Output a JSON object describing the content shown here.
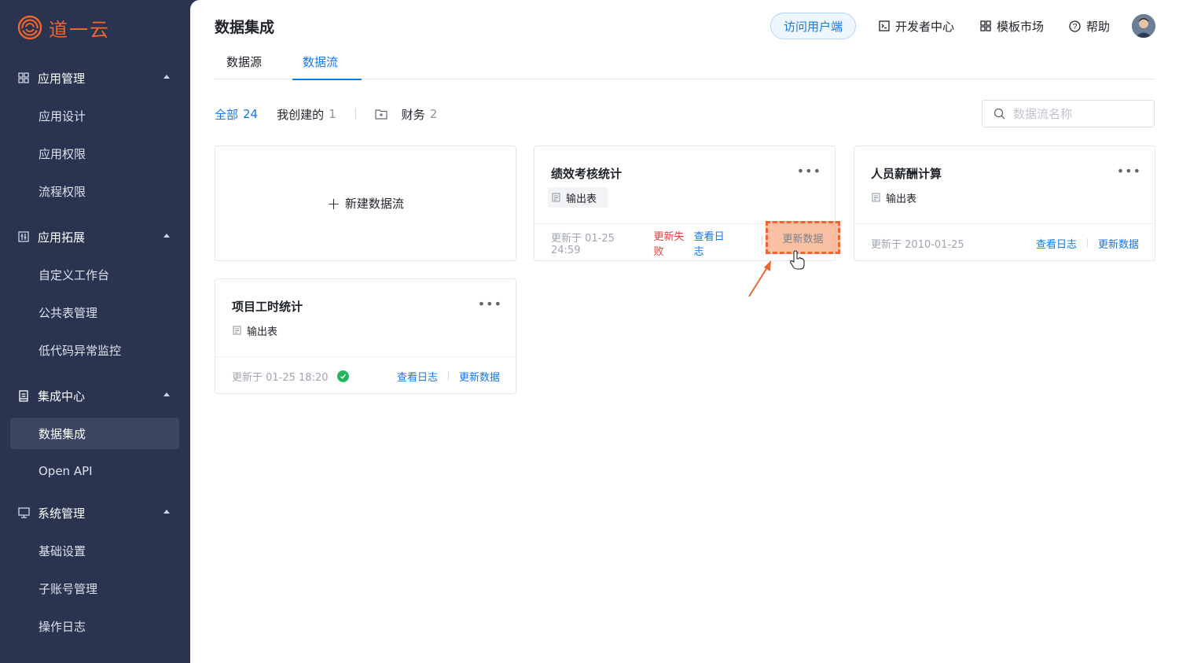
{
  "brand": {
    "name": "道一云",
    "color": "#f0652f"
  },
  "sidebar": {
    "groups": [
      {
        "label": "应用管理",
        "icon": "grid-icon",
        "items": [
          "应用设计",
          "应用权限",
          "流程权限"
        ]
      },
      {
        "label": "应用拓展",
        "icon": "extension-icon",
        "items": [
          "自定义工作台",
          "公共表管理",
          "低代码异常监控"
        ]
      },
      {
        "label": "集成中心",
        "icon": "document-icon",
        "items": [
          "数据集成",
          "Open API"
        ]
      },
      {
        "label": "系统管理",
        "icon": "monitor-icon",
        "items": [
          "基础设置",
          "子账号管理",
          "操作日志"
        ]
      }
    ],
    "active_item": "数据集成"
  },
  "header": {
    "title": "数据集成",
    "visit_button": "访问用户端",
    "links": {
      "developer": "开发者中心",
      "market": "模板市场",
      "help": "帮助"
    }
  },
  "tabs": [
    "数据源",
    "数据流"
  ],
  "active_tab": "数据流",
  "filters": {
    "all": {
      "label": "全部",
      "count": "24"
    },
    "mine": {
      "label": "我创建的",
      "count": "1"
    },
    "folder": {
      "label": "财务",
      "count": "2"
    }
  },
  "search": {
    "placeholder": "数据流名称"
  },
  "new_card": {
    "label": "新建数据流"
  },
  "cards": [
    {
      "title": "绩效考核统计",
      "tag": "输出表",
      "updated": "更新于  01-25  24:59",
      "status": "更新失败",
      "view_log": "查看日志",
      "refresh": "更新数据"
    },
    {
      "title": "人员薪酬计算",
      "tag": "输出表",
      "updated": "更新于 2010-01-25",
      "view_log": "查看日志",
      "refresh": "更新数据"
    },
    {
      "title": "项目工时统计",
      "tag": "输出表",
      "updated": "更新于 01-25 18:20",
      "status": "success",
      "view_log": "查看日志",
      "refresh": "更新数据"
    }
  ],
  "colors": {
    "accent": "#1677e5",
    "sidebar_bg": "#2a3450",
    "error": "#e23c39",
    "success": "#22b55e",
    "highlight": "#f0652f"
  }
}
